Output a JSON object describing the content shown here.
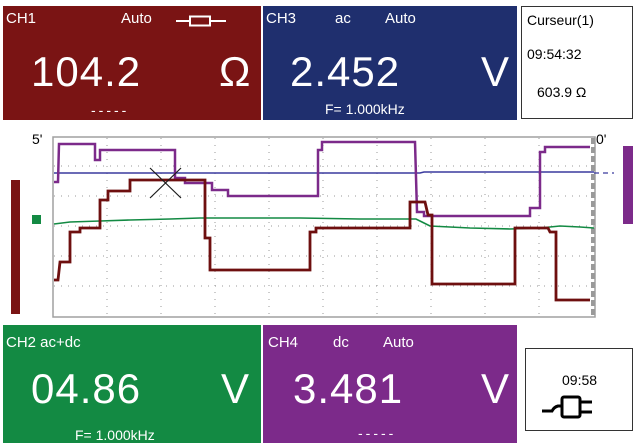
{
  "ch1": {
    "name": "CH1",
    "mode": "Auto",
    "value": "104.2",
    "unit": "Ω",
    "sub": "-----",
    "color": "#7a1414"
  },
  "ch3": {
    "name": "CH3",
    "coupling": "ac",
    "mode": "Auto",
    "value": "2.452",
    "unit": "V",
    "sub": "F= 1.000kHz",
    "color": "#1f2f6e"
  },
  "cursor": {
    "title": "Curseur(1)",
    "time": "09:54:32",
    "value": "603.9 Ω"
  },
  "ch2": {
    "name": "CH2 ac+dc",
    "value": "04.86",
    "unit": "V",
    "sub": "F= 1.000kHz",
    "color": "#138a43"
  },
  "ch4": {
    "name": "CH4",
    "coupling": "dc",
    "mode": "Auto",
    "value": "3.481",
    "unit": "V",
    "sub": "-----",
    "color": "#7c2a8a"
  },
  "clock": {
    "time": "09:58"
  },
  "scope": {
    "left_time": "5'",
    "right_time": "0'"
  },
  "icons": {
    "ch1_mode": "resistor-icon",
    "power": "ac-plug-icon",
    "cursor": "cross-cursor-icon"
  }
}
